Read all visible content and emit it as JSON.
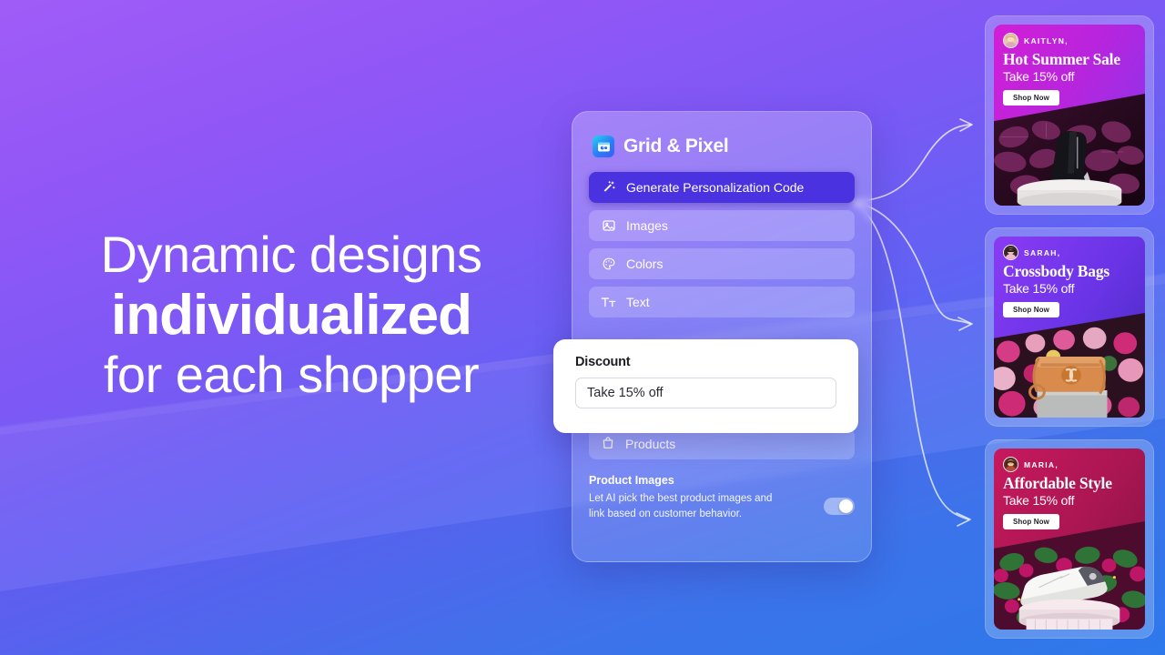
{
  "headline": {
    "line1": "Dynamic designs",
    "line2": "individualized",
    "line3": "for each shopper"
  },
  "panel": {
    "brand": "Grid & Pixel",
    "menu": [
      {
        "label": "Generate Personalization Code",
        "icon": "magic-wand-icon",
        "active": true
      },
      {
        "label": "Images",
        "icon": "image-icon",
        "active": false
      },
      {
        "label": "Colors",
        "icon": "palette-icon",
        "active": false
      },
      {
        "label": "Text",
        "icon": "text-format-icon",
        "active": false
      }
    ],
    "products": {
      "label": "Products",
      "icon": "shopping-bag-icon"
    },
    "product_images": {
      "title": "Product Images",
      "description": "Let AI pick the best product images and link based on customer behavior.",
      "toggle_on": true
    }
  },
  "discount_card": {
    "label": "Discount",
    "value": "Take 15% off",
    "placeholder": "Take 15% off"
  },
  "ads": [
    {
      "name": "KAITLYN,",
      "headline": "Hot Summer Sale",
      "subhead": "Take 15% off",
      "cta": "Shop Now",
      "bg_from": "#d21fd6",
      "bg_to": "#7a3af0",
      "photo_tone": "#2b0d22"
    },
    {
      "name": "SARAH,",
      "headline": "Crossbody Bags",
      "subhead": "Take 15% off",
      "cta": "Shop Now",
      "bg_from": "#7a3bf2",
      "bg_to": "#4a32c8",
      "photo_tone": "#c44a7e"
    },
    {
      "name": "MARIA,",
      "headline": "Affordable Style",
      "subhead": "Take 15% off",
      "cta": "Shop Now",
      "bg_from": "#c2175c",
      "bg_to": "#8e1545",
      "photo_tone": "#9d1050"
    }
  ],
  "colors": {
    "bg_top": "#a05cf7",
    "bg_bottom": "#2f7ef0",
    "accent": "#4a32e0",
    "panel_glass": "rgba(255,255,255,0.20)"
  }
}
